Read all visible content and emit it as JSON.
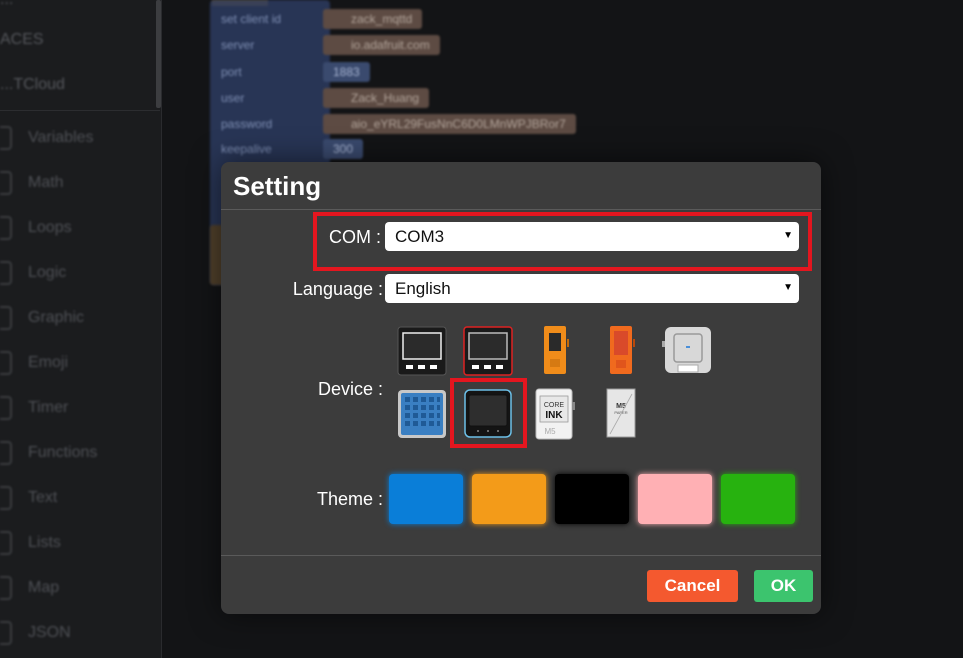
{
  "sidebar": {
    "top_items": [
      "...",
      "ACES",
      "...TCloud"
    ],
    "categories": [
      "Variables",
      "Math",
      "Loops",
      "Logic",
      "Graphic",
      "Emoji",
      "Timer",
      "Functions",
      "Text",
      "Lists",
      "Map",
      "JSON"
    ]
  },
  "workspace": {
    "block_rows": [
      {
        "label": "set client id",
        "value": "zack_mqttd"
      },
      {
        "label": "server",
        "value": "io.adafruit.com"
      },
      {
        "label": "port",
        "value": "1883"
      },
      {
        "label": "user",
        "value": "Zack_Huang"
      },
      {
        "label": "password",
        "value": "aio_eYRL29FusNnC6D0LMnWPJBRor7"
      },
      {
        "label": "keepalive",
        "value": "300"
      }
    ]
  },
  "dialog": {
    "title": "Setting",
    "com": {
      "label": "COM :",
      "value": "COM3"
    },
    "language": {
      "label": "Language :",
      "value": "English"
    },
    "device": {
      "label": "Device :",
      "options": [
        "m5stack-black",
        "m5stack-red",
        "m5stick-c-orange",
        "m5stick-c-plus-orange",
        "m5atom-lite",
        "m5atom-matrix",
        "m5core2",
        "m5coreink",
        "m5paper"
      ],
      "selected": "m5core2"
    },
    "theme": {
      "label": "Theme :",
      "colors": [
        "#0a7ed8",
        "#f39b19",
        "#000000",
        "#ffb0b4",
        "#27b20f"
      ]
    },
    "cancel_label": "Cancel",
    "ok_label": "OK"
  },
  "colors": {
    "highlight": "#e4161f",
    "cancel": "#f4592f",
    "ok": "#3cc46e"
  }
}
